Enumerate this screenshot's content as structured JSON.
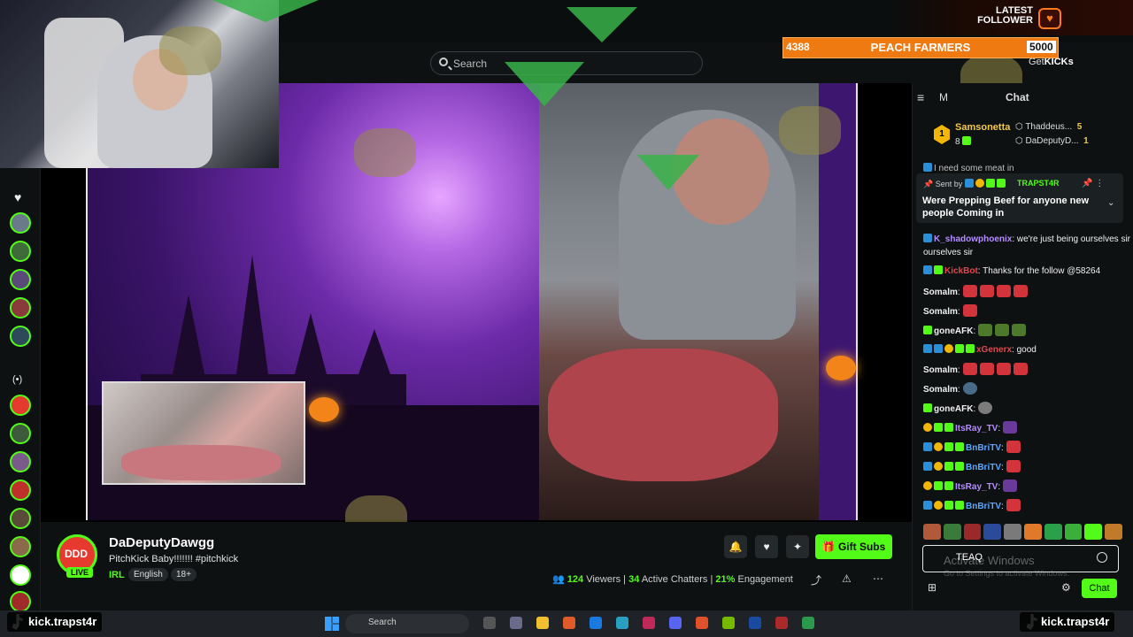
{
  "header": {
    "search_placeholder": "Search",
    "getkicks_prefix": "Get",
    "getkicks_brand": "KICKs"
  },
  "goal": {
    "title_line1": "LATEST",
    "title_line2": "FOLLOWER",
    "current": "4388",
    "label": "PEACH FARMERS",
    "target": "5000"
  },
  "sidebar": {
    "live_icon": "(•)"
  },
  "channel": {
    "avatar_text": "DDD",
    "live_badge": "LIVE",
    "name": "DaDeputyDawgg",
    "title": "PitchKick Baby!!!!!!! #pitchkick",
    "category": "IRL",
    "tags": [
      "English",
      "18+"
    ],
    "gift_label": "Gift Subs",
    "viewers_count": "124",
    "viewers_label": "Viewers",
    "chatters_count": "34",
    "chatters_label": "Active Chatters",
    "engagement_pct": "21%",
    "engagement_label": "Engagement"
  },
  "chat": {
    "header_m": "M",
    "title": "Chat",
    "leaderboard": [
      {
        "rank": "1",
        "name": "Samsonetta",
        "count": "8"
      },
      {
        "name": "Thaddeus...",
        "count": "5"
      },
      {
        "name": "DaDeputyD...",
        "count": "1"
      }
    ],
    "pinned": {
      "sent_by": "Sent by",
      "user": "TRAPST4R",
      "message": "Were Prepping Beef for anyone new people Coming in"
    },
    "partial_line": "I need some meat in",
    "messages": [
      {
        "user": "K_shadowphoenix",
        "color": "#b58cff",
        "text": ": we're just being ourselves sir"
      },
      {
        "user": "KickBot",
        "color": "#e0484e",
        "text": ": Thanks for the follow @58264"
      },
      {
        "user": "Somalm",
        "color": "#ffffff",
        "text": ":"
      },
      {
        "user": "Somalm",
        "color": "#ffffff",
        "text": ":"
      },
      {
        "user": "goneAFK",
        "color": "#ffffff",
        "text": ":"
      },
      {
        "user": "xGenerx",
        "color": "#e0484e",
        "text": ": good"
      },
      {
        "user": "Somalm",
        "color": "#ffffff",
        "text": ":"
      },
      {
        "user": "Somalm",
        "color": "#ffffff",
        "text": ":"
      },
      {
        "user": "goneAFK",
        "color": "#ffffff",
        "text": ":"
      },
      {
        "user": "ItsRay_TV",
        "color": "#b58cff",
        "text": ":"
      },
      {
        "user": "BnBriTV",
        "color": "#5aa7ff",
        "text": ":"
      },
      {
        "user": "BnBriTV",
        "color": "#5aa7ff",
        "text": ":"
      },
      {
        "user": "ItsRay_TV",
        "color": "#b58cff",
        "text": ":"
      },
      {
        "user": "BnBriTV",
        "color": "#5aa7ff",
        "text": ":"
      }
    ],
    "input_value": "TEAQ",
    "windows_watermark1": "Activate Windows",
    "windows_watermark2": "Go to Settings to activate Windows.",
    "send_label": "Chat"
  },
  "taskbar": {
    "search_placeholder": "Search",
    "tag_left": "kick.trapst4r",
    "tag_right": "kick.trapst4r"
  },
  "colors": {
    "accent": "#53fc18",
    "goal_orange": "#f07a12",
    "background": "#0e1112"
  }
}
